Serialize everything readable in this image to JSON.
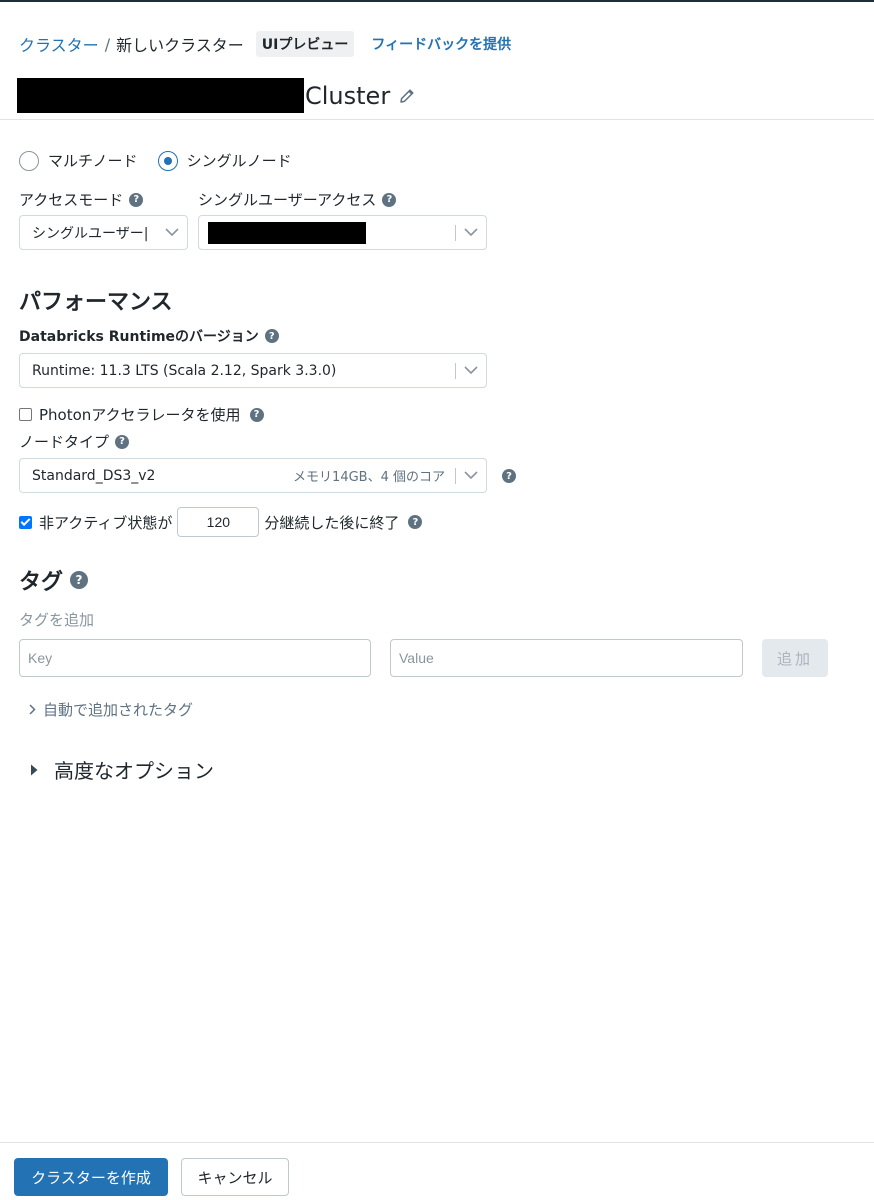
{
  "breadcrumb": {
    "parent": "クラスター",
    "separator": "/",
    "current": "新しいクラスター"
  },
  "header": {
    "preview_badge": "UIプレビュー",
    "feedback_link": "フィードバックを提供",
    "cluster_suffix": "Cluster"
  },
  "node_mode": {
    "options": [
      "マルチノード",
      "シングルノード"
    ],
    "selected": "シングルノード"
  },
  "access_mode": {
    "label": "アクセスモード",
    "value": "シングルユーザー|"
  },
  "single_user_access": {
    "label": "シングルユーザーアクセス",
    "value": ""
  },
  "performance": {
    "heading": "パフォーマンス",
    "runtime_label": "Databricks Runtimeのバージョン",
    "runtime_value": "Runtime: 11.3 LTS (Scala 2.12, Spark 3.3.0)",
    "photon_label": "Photonアクセラレータを使用",
    "photon_checked": false,
    "node_type_label": "ノードタイプ",
    "node_type_value": "Standard_DS3_v2",
    "node_type_detail": "メモリ14GB、4 個のコア",
    "idle_prefix": "非アクティブ状態が",
    "idle_minutes": "120",
    "idle_suffix": "分継続した後に終了",
    "idle_checked": true
  },
  "tags": {
    "heading": "タグ",
    "add_label": "タグを追加",
    "key_placeholder": "Key",
    "value_placeholder": "Value",
    "add_button": "追加",
    "auto_tags": "自動で追加されたタグ"
  },
  "advanced": {
    "label": "高度なオプション"
  },
  "footer": {
    "create_button": "クラスターを作成",
    "cancel_button": "キャンセル"
  },
  "colors": {
    "accent": "#2272b4",
    "text": "#1f272d",
    "muted": "#5f7281"
  },
  "icons": [
    "pencil-icon",
    "help-icon",
    "chevron-down-icon",
    "chevron-right-icon",
    "caret-right-icon"
  ]
}
